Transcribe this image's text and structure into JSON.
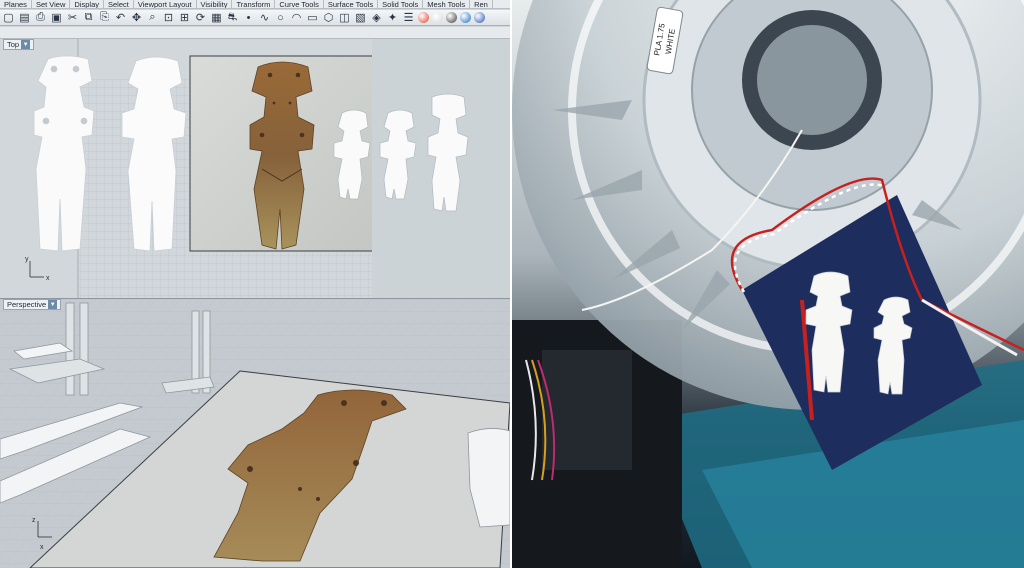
{
  "menubar": {
    "tabs": [
      "Planes",
      "Set View",
      "Display",
      "Select",
      "Viewport Layout",
      "Visibility",
      "Transform",
      "Curve Tools",
      "Surface Tools",
      "Solid Tools",
      "Mesh Tools",
      "Ren"
    ]
  },
  "toolbar": {
    "icons": [
      "new-file-icon",
      "save-icon",
      "print-icon",
      "open-icon",
      "cut-icon",
      "copy-icon",
      "paste-icon",
      "undo-icon",
      "pan-icon",
      "zoom-icon",
      "zoom-window-icon",
      "zoom-extents-icon",
      "rotate-view-icon",
      "grid-icon",
      "car-icon",
      "point-icon",
      "curve-icon",
      "circle-icon",
      "arc-icon",
      "rectangle-icon",
      "polygon-icon",
      "surface-icon",
      "solid-icon",
      "mesh-icon",
      "light-icon",
      "layer-icon",
      "color-wheel-icon",
      "render-icon",
      "shade-icon",
      "material-icon",
      "globe-icon"
    ]
  },
  "viewports": {
    "top": {
      "label": "Top",
      "axis_y": "y",
      "axis_x": "x"
    },
    "perspective": {
      "label": "Perspective",
      "axis_y": "z",
      "axis_x": "x"
    }
  },
  "spool_label": {
    "line1": "PLA 1.75",
    "line2": "WHITE"
  },
  "colors": {
    "viewport_bg": "#d1d7db",
    "accent": "#6d8aa8",
    "card": "#1d2d5e",
    "string_red": "#c8201e"
  }
}
